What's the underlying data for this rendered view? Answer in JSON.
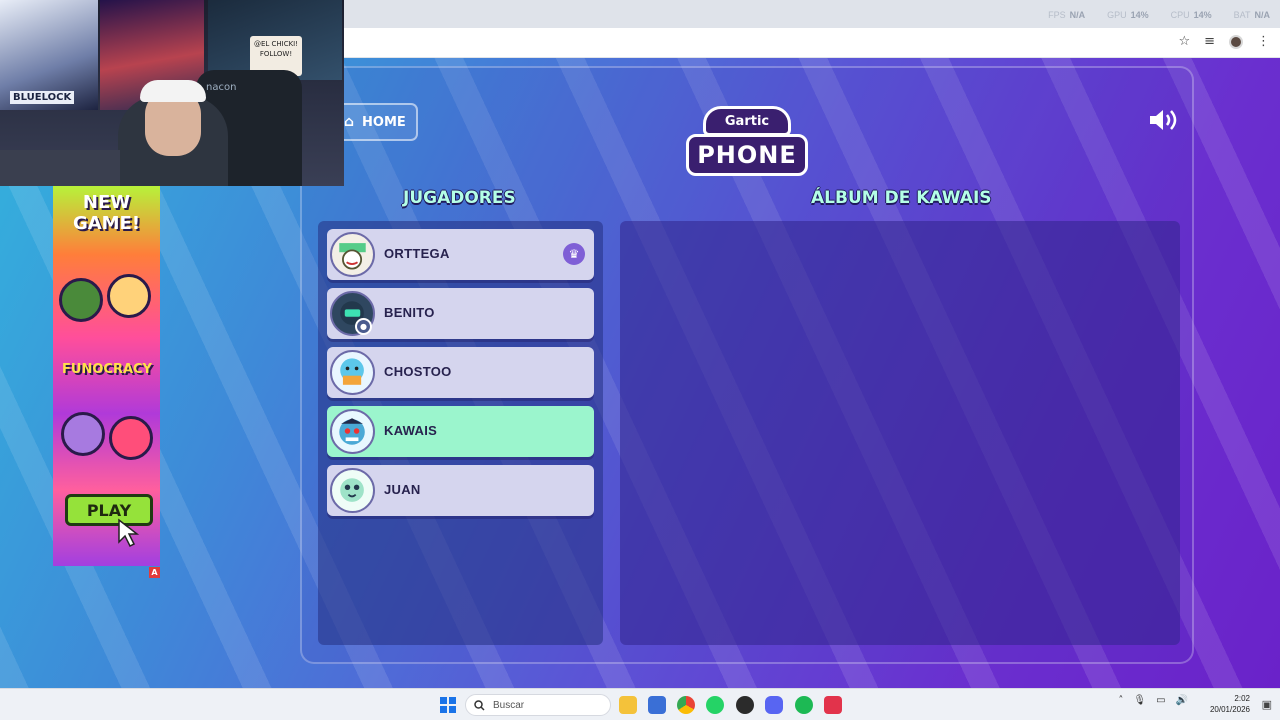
{
  "overlay_stats": [
    {
      "label": "FPS",
      "value": "N/A"
    },
    {
      "label": "GPU",
      "value": "14%"
    },
    {
      "label": "CPU",
      "value": "14%"
    },
    {
      "label": "BAT",
      "value": "N/A"
    }
  ],
  "game": {
    "home_label": "HOME",
    "logo_top": "Gartic",
    "logo_bottom": "PHONE",
    "players_title": "JUGADORES",
    "album_title": "ÁLBUM DE KAWAIS",
    "players": [
      {
        "name": "ORTTEGA",
        "host": true,
        "active": false,
        "avatar_color": "#7fd7a8"
      },
      {
        "name": "BENITO",
        "host": false,
        "active": false,
        "avatar_color": "#3e5673"
      },
      {
        "name": "CHOSTOO",
        "host": false,
        "active": false,
        "avatar_color": "#5cc7ea"
      },
      {
        "name": "KAWAIS",
        "host": false,
        "active": true,
        "avatar_color": "#4aa9d6"
      },
      {
        "name": "JUAN",
        "host": false,
        "active": false,
        "avatar_color": "#9ee3c8"
      }
    ]
  },
  "ad": {
    "headline_line1": "NEW",
    "headline_line2": "GAME!",
    "brand": "FUNOCRACY",
    "play_label": "PLAY",
    "marker": "A"
  },
  "webcam": {
    "poster_caption_1": "BLUELOCK",
    "sign_text": "@EL CHICKI! FOLLOW!",
    "chair_brand": "nacon"
  },
  "taskbar": {
    "search_placeholder": "Buscar",
    "time": "2:02",
    "date": "20/01/2026"
  }
}
